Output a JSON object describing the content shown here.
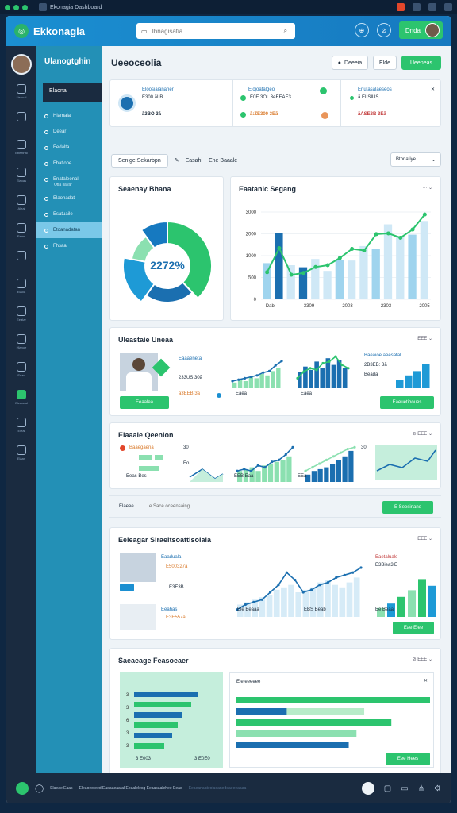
{
  "titlebar": {
    "tab_label": "Ekonagia Dashboard"
  },
  "header": {
    "app_name": "Ekkonagia",
    "search_placeholder": "Ihnagisatia",
    "user_button": "Dnda"
  },
  "sidebar": {
    "title": "Ulanogtghin",
    "section_label": "Elaona",
    "items": [
      {
        "label": "Hiamaia"
      },
      {
        "label": "Deear"
      },
      {
        "label": "Eedalta"
      },
      {
        "label": "Fhatione"
      },
      {
        "label": "Enataleonal",
        "sub": "Otla Ilavar"
      },
      {
        "label": "Elaonadat"
      },
      {
        "label": "Esatuaile"
      },
      {
        "label": "Etoanadatan"
      },
      {
        "label": "Fhsaa"
      }
    ]
  },
  "rail": {
    "items": [
      "Ueoual",
      "",
      "Ebeeinal",
      "Elaoas",
      "Aleai",
      "Eeani",
      "",
      "Elaoa",
      "Eeatar",
      "Hlanoe",
      "Enan",
      "Eleaoeal",
      "Eleal",
      "Elaan"
    ]
  },
  "page": {
    "title": "Ueeoceolia",
    "btn_one": "Deeeia",
    "btn_two": "Elde",
    "btn_three": "Ueeneas"
  },
  "kpis": [
    {
      "title": "Eloosiaiananer",
      "line1": "E300 ãLB",
      "value": "ã3BO 3ã"
    },
    {
      "title": "Elojoatalgeoi",
      "line1": "E0E 3OL 3eEEAE3",
      "value": "ã:ZE300 3Eã"
    },
    {
      "title": "Enutasalaeseos",
      "line1": "ã ELSIUS",
      "value": "ãASE3B 3Eã"
    }
  ],
  "filterbar": {
    "chip": "Senige:Sekarbpn",
    "link1": "Easahi",
    "link2": "Ene Baaale",
    "dropdown": "Bthnatiye"
  },
  "donut_card": {
    "title": "Seaenay Bhana",
    "center": "2272%"
  },
  "chart_data": [
    {
      "type": "bar",
      "title": "Eaatanic Segang",
      "y_ticks": [
        "3000",
        "2000",
        "1000",
        "500",
        "0"
      ],
      "x_ticks": [
        "Dabi",
        "3309",
        "2003",
        "2303",
        "2005"
      ],
      "series": [
        {
          "values": [
            1400,
            2550,
            1320,
            1240,
            1560,
            1100,
            1530,
            1500,
            2060,
            1950,
            2900,
            2450,
            2500,
            3030
          ]
        },
        {
          "values": [
            1050,
            1980,
            950,
            1020,
            1250,
            1320,
            1600,
            1950,
            1890,
            2520,
            2550,
            2380,
            2700,
            3280
          ]
        }
      ],
      "ylim": [
        0,
        3500
      ],
      "legend": "top-right"
    },
    {
      "type": "pie",
      "title": "Seaenay Bhana",
      "values": [
        38,
        22,
        18,
        12,
        10
      ]
    }
  ],
  "colors": {
    "accent": "#1b8fd1",
    "green": "#2cc46e",
    "dark": "#1a2b40",
    "navy": "#1b6fb0"
  },
  "card2": {
    "title": "Uleastaie Uneaa",
    "ctrl": "EEE",
    "metric1": "Eaaaenetal",
    "metric2": "233US 30ã",
    "metric3": "ã3EEB 3ã",
    "btn": "Eeaalea",
    "right1": "Baeaioe aeesatal",
    "right2": "2B3EB: 3ã",
    "right3": "Beada",
    "btn2": "Eaeuetiooues",
    "x1": "Eaea",
    "x2": "Eaea"
  },
  "card3": {
    "title": "Elaaaie Qeenion",
    "ctrl": "EEE",
    "legend1": "Baaegaena",
    "x1": "Eeas Bes",
    "y1": "30",
    "y2": "Eo",
    "y3": "30",
    "x2": "EEB Eaa",
    "x3": "EEa"
  },
  "strip": {
    "label": "Elaeee",
    "text": "e Sace oceensaing",
    "btn": "E Seesinane"
  },
  "card4": {
    "title": "Eeleagar Siraeltsoattisoiala",
    "ctrl": "EEE",
    "a1": "Eaaduala",
    "a2": "E500327ã",
    "a3": "E3E3B",
    "b1": "Eeahas",
    "b2": "E3E557ã",
    "r1": "Eaetaluale",
    "r2": "E3Biea3iE",
    "l1": "Ele Beaaa",
    "l2": "EBS Beab",
    "l3": "Ee Beaa",
    "btn": "Eae Eiee"
  },
  "card5": {
    "title": "Saeaeage Feasoeaer",
    "ctrl": "EEE",
    "rows": [
      "3",
      "3",
      "6",
      "3",
      "3"
    ],
    "foot1": "3 E003",
    "foot2": "3 E0E0",
    "panel_title": "Ele eeeeee",
    "btn": "Eee Hees"
  },
  "bottombar": {
    "text1": "Elaeae Eaas",
    "text2": "Eleaoeoteed Eaeaaeaatal Eeaalelesg Eeaasaalehee Eeae",
    "text3": "Eeaeanaateoiaoanedeaeeeaaaa"
  }
}
